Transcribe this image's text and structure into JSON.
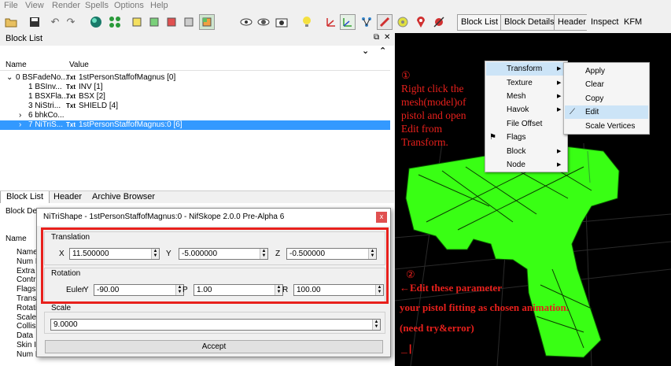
{
  "menu": [
    "File",
    "View",
    "Render",
    "Spells",
    "Options",
    "Help"
  ],
  "right_tabs": [
    "Block List",
    "Block Details",
    "Header",
    "Inspect",
    "KFM"
  ],
  "block_list": {
    "title": "Block List",
    "col_name": "Name",
    "col_value": "Value",
    "rows": [
      {
        "name": "0 BSFadeNo...",
        "value": "1stPersonStaffofMagnus [0]"
      },
      {
        "name": "1 BSInv...",
        "value": "INV [1]"
      },
      {
        "name": "1 BSXFla...",
        "value": "BSX [2]"
      },
      {
        "name": "3 NiStri...",
        "value": "SHIELD [4]"
      },
      {
        "name": "6 bhkCo...",
        "value": ""
      },
      {
        "name": "7 NiTriS...",
        "value": "1stPersonStaffofMagnus:0 [6]"
      }
    ],
    "txt": "Txt"
  },
  "bottom_tabs": [
    "Block List",
    "Header",
    "Archive Browser"
  ],
  "details_title": "Block Deta",
  "details_col": "Name",
  "details_rows": [
    "Name",
    "Num B",
    "Extra D",
    "Contro",
    "Flags",
    "Transl",
    "Rotati",
    "Scale",
    "Collisi",
    "Data",
    "Skin In",
    "Num M"
  ],
  "dialog": {
    "title": "NiTriShape - 1stPersonStaffofMagnus:0 - NifSkope 2.0.0 Pre-Alpha 6",
    "close": "x",
    "translation_label": "Translation",
    "x_label": "X",
    "x": "11.500000",
    "y_label": "Y",
    "y": "-5.000000",
    "z_label": "Z",
    "z": "-0.500000",
    "rotation_label": "Rotation",
    "euler": "Euler",
    "ry_label": "Y",
    "ry": "-90.00",
    "p_label": "P",
    "p": "1.00",
    "r_label": "R",
    "r": "100.00",
    "scale_label": "Scale",
    "scale": "9.0000",
    "accept": "Accept"
  },
  "context_menu": {
    "items": [
      "Transform",
      "Texture",
      "Mesh",
      "Havok",
      "File Offset",
      "Flags",
      "Block",
      "Node"
    ],
    "sub": [
      "Apply",
      "Clear",
      "Copy",
      "Edit",
      "Scale Vertices"
    ]
  },
  "annotations": {
    "n1": "①",
    "t1": [
      "Right click the",
      "mesh(model)of",
      "pistol and open",
      "Edit from",
      "Transform."
    ],
    "n2": "②",
    "t2": "←Edit these parameter",
    "t3": "your pistol fitting as chosen animation.",
    "t4": "(need try&error)",
    "mark": "_|"
  },
  "colors": {
    "highlight": "#3399ff",
    "red": "#e8201c",
    "green": "#39ff14"
  }
}
